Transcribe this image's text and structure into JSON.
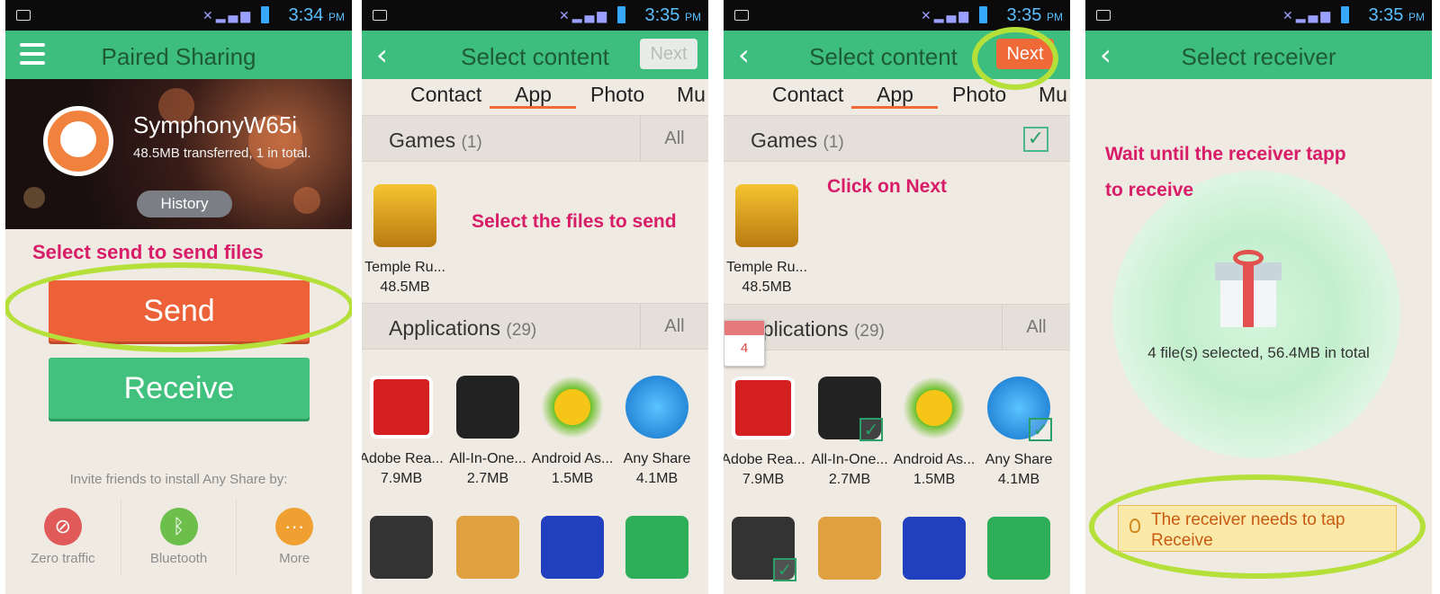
{
  "screens": [
    {
      "status_time": "3:34",
      "status_ampm": "PM",
      "title": "Paired Sharing",
      "device_name": "SymphonyW65i",
      "device_stats": "48.5MB transferred, 1 in total.",
      "history_label": "History",
      "annotation": "Select send to send files",
      "send_label": "Send",
      "receive_label": "Receive",
      "invite_text": "Invite friends to install Any Share by:",
      "share_options": [
        {
          "label": "Zero traffic",
          "icon": "zero-traffic-icon",
          "color": "#e05a5a"
        },
        {
          "label": "Bluetooth",
          "icon": "bluetooth-icon",
          "color": "#6cbf4a"
        },
        {
          "label": "More",
          "icon": "more-icon",
          "color": "#f0a030"
        }
      ]
    },
    {
      "status_time": "3:35",
      "status_ampm": "PM",
      "title": "Select content",
      "next_label": "Next",
      "tabs": [
        "Contact",
        "App",
        "Photo",
        "Mu"
      ],
      "annotation": "Select the files to send",
      "games_section": {
        "name": "Games",
        "count": "(1)",
        "action": "All"
      },
      "applications_section": {
        "name": "Applications",
        "count": "(29)",
        "action": "All"
      },
      "game_app": {
        "name": "Temple Ru...",
        "size": "48.5MB"
      },
      "apps": [
        {
          "name": "Adobe Rea...",
          "size": "7.9MB",
          "icon": "adobe-reader-icon"
        },
        {
          "name": "All-In-One...",
          "size": "2.7MB",
          "icon": "all-in-one-icon"
        },
        {
          "name": "Android As...",
          "size": "1.5MB",
          "icon": "android-assistant-icon"
        },
        {
          "name": "Any Share",
          "size": "4.1MB",
          "icon": "any-share-icon"
        }
      ],
      "bottom_apps": [
        "battery-app-icon",
        "contacts-app-icon",
        "dictionary-app-icon",
        "espn-app-icon"
      ]
    },
    {
      "status_time": "3:35",
      "status_ampm": "PM",
      "title": "Select content",
      "next_label": "Next",
      "tabs": [
        "Contact",
        "App",
        "Photo",
        "Mu"
      ],
      "annotation": "Click on Next",
      "games_section": {
        "name": "Games",
        "count": "(1)"
      },
      "applications_section": {
        "name": "Applications",
        "name_visible": "pplications",
        "count": "(29)",
        "action": "All"
      },
      "selected_badge": "4",
      "game_app": {
        "name": "Temple Ru...",
        "size": "48.5MB"
      },
      "apps": [
        {
          "name": "Adobe Rea...",
          "size": "7.9MB",
          "selected": false
        },
        {
          "name": "All-In-One...",
          "size": "2.7MB",
          "selected": true
        },
        {
          "name": "Android As...",
          "size": "1.5MB",
          "selected": false
        },
        {
          "name": "Any Share",
          "size": "4.1MB",
          "selected": true
        }
      ]
    },
    {
      "status_time": "3:35",
      "status_ampm": "PM",
      "title": "Select receiver",
      "annotation_line1": "Wait until the receiver tapp",
      "annotation_line2": "to receive",
      "selection_info": "4 file(s) selected, 56.4MB in total",
      "notice": "The receiver needs to tap Receive"
    }
  ],
  "colors": {
    "header_green": "#3dbe7f",
    "send_orange": "#ec6137",
    "receive_green": "#42c07d",
    "annotation_pink": "#d81c68",
    "highlight_lime": "#b5e03a"
  }
}
